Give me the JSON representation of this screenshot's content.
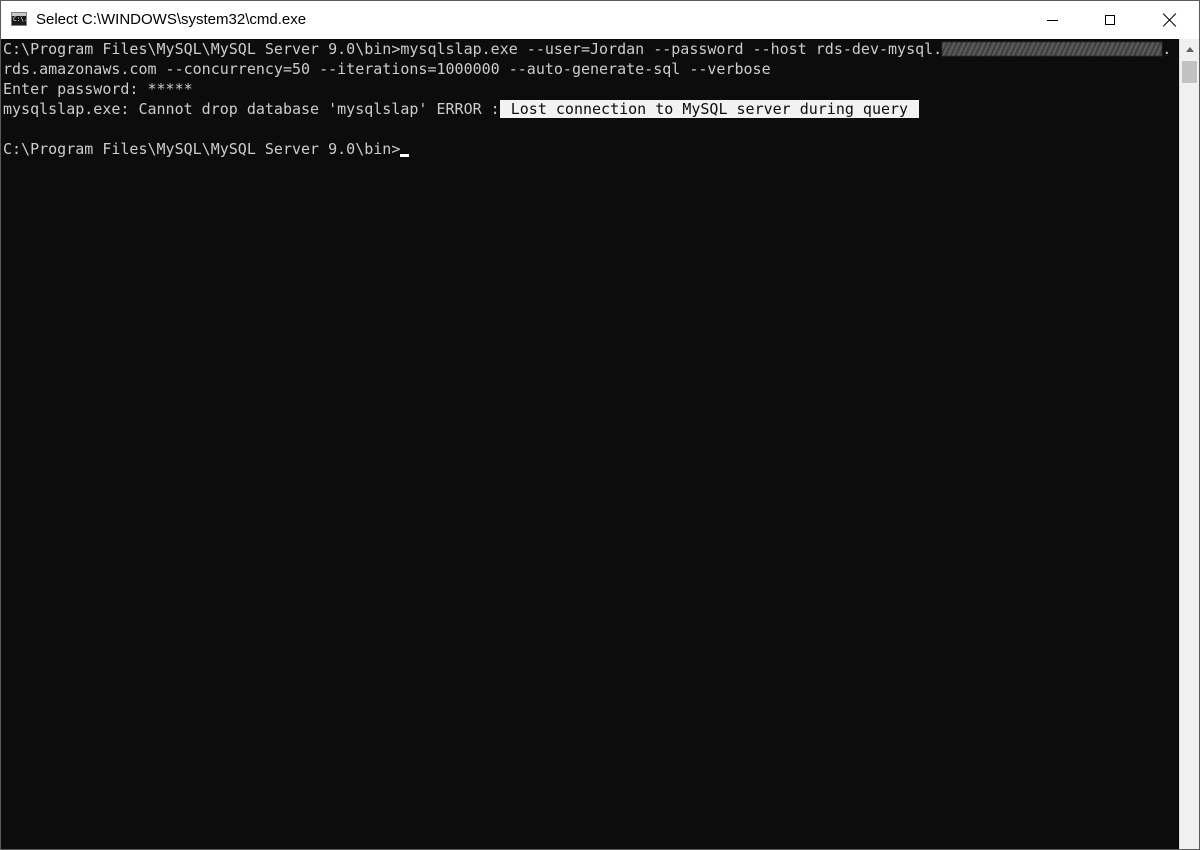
{
  "window": {
    "title": "Select C:\\WINDOWS\\system32\\cmd.exe",
    "icon": "cmd-app-icon",
    "icon_glyph": "C:\\."
  },
  "controls": {
    "minimize": "minimize-icon",
    "maximize": "maximize-icon",
    "close": "close-icon"
  },
  "console": {
    "line1_prefix": "C:\\Program Files\\MySQL\\MySQL Server 9.0\\bin>mysqlslap.exe --user=Jordan --password --host rds-dev-mysql.",
    "line1_suffix": ".",
    "line2": "rds.amazonaws.com --concurrency=50 --iterations=1000000 --auto-generate-sql --verbose",
    "line3": "Enter password: *****",
    "line4_prefix": "mysqlslap.exe: Cannot drop database 'mysqlslap' ERROR :",
    "line4_highlight": " Lost connection to MySQL server during query ",
    "prompt": "C:\\Program Files\\MySQL\\MySQL Server 9.0\\bin>"
  },
  "colors": {
    "console_background": "#0c0c0c",
    "console_text": "#cccccc",
    "selection_background": "#f2f2f2",
    "titlebar_background": "#ffffff"
  }
}
